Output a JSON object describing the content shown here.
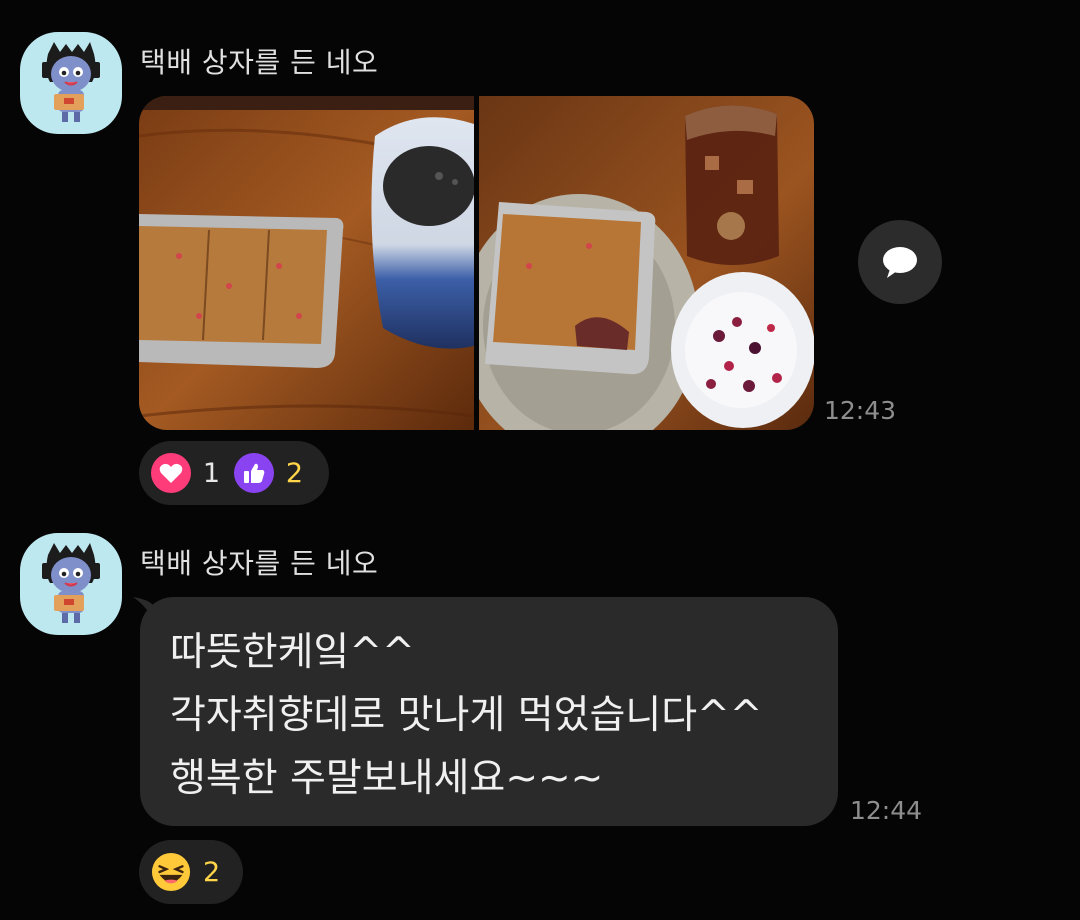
{
  "messages": [
    {
      "sender": "택배 상자를 든 네오",
      "type": "photos",
      "time": "12:43",
      "reactions": [
        {
          "icon": "heart-icon",
          "count": "1",
          "color": "#ff3c7a"
        },
        {
          "icon": "thumbs-up-icon",
          "count": "2",
          "color": "#8a43f0"
        }
      ]
    },
    {
      "sender": "택배 상자를 든 네오",
      "type": "text",
      "lines": [
        "따뜻한케잌^^",
        "각자취향데로 맛나게 먹었습니다^^",
        "행복한 주말보내세요~~~"
      ],
      "time": "12:44",
      "reactions": [
        {
          "icon": "laughing-face-icon",
          "count": "2"
        }
      ]
    }
  ],
  "colors": {
    "background": "#050505",
    "bubble": "#2a2a2a",
    "reaction_pill": "#222222",
    "avatar_bg": "#bde8f0",
    "count_highlight": "#ffd54a"
  }
}
